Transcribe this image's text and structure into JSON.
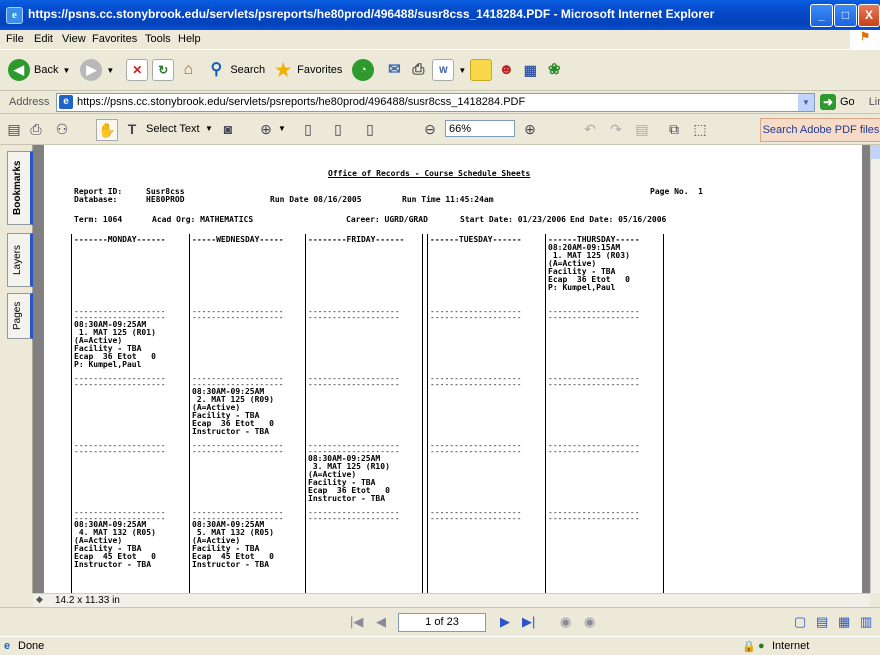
{
  "window": {
    "title": "https://psns.cc.stonybrook.edu/servlets/psreports/he80prod/496488/susr8css_1418284.PDF - Microsoft Internet Explorer",
    "app_icon": "ie-icon",
    "minimize": "_",
    "maximize": "□",
    "close": "X"
  },
  "menu": [
    "File",
    "Edit",
    "View",
    "Favorites",
    "Tools",
    "Help"
  ],
  "toolbar": {
    "back_label": "Back",
    "search_label": "Search",
    "favorites_label": "Favorites"
  },
  "address": {
    "label": "Address",
    "url": "https://psns.cc.stonybrook.edu/servlets/psreports/he80prod/496488/susr8css_1418284.PDF",
    "go_label": "Go",
    "links_label": "Links"
  },
  "pdf_toolbar": {
    "select_text": "Select Text",
    "zoom": "66%",
    "search_pdf": "Search Adobe PDF files"
  },
  "side_tabs": [
    "Bookmarks",
    "Layers",
    "Pages"
  ],
  "report": {
    "title": "Office of Records - Course Schedule Sheets",
    "report_id_label": "Report ID:",
    "report_id": "Susr8css",
    "database_label": "Database:",
    "database": "HE80PROD",
    "run_date": "Run Date 08/16/2005",
    "run_time": "Run Time 11:45:24am",
    "page_no": "Page No.  1",
    "term": "Term: 1064",
    "acad_org": "Acad Org: MATHEMATICS",
    "career": "Career: UGRD/GRAD",
    "start_date": "Start Date: 01/23/2006",
    "end_date": "End Date: 05/16/2006",
    "day_headers": [
      "-------MONDAY------",
      "-----WEDNESDAY-----",
      "--------FRIDAY------",
      "------TUESDAY------",
      "------THURSDAY-----"
    ],
    "entries": [
      {
        "day": "thursday",
        "lines": [
          "08:20AM-09:15AM",
          " 1. MAT 125 (R03)",
          "(A=Active)",
          "Facility - TBA",
          "Ecap  36 Etot   0",
          "P: Kumpel,Paul"
        ]
      },
      {
        "day": "monday",
        "lines": [
          "08:30AM-09:25AM",
          " 1. MAT 125 (R01)",
          "(A=Active)",
          "Facility - TBA",
          "Ecap  36 Etot   0",
          "P: Kumpel,Paul"
        ]
      },
      {
        "day": "wednesday",
        "lines": [
          "08:30AM-09:25AM",
          " 2. MAT 125 (R09)",
          "(A=Active)",
          "Facility - TBA",
          "Ecap  36 Etot   0",
          "Instructor - TBA"
        ]
      },
      {
        "day": "friday",
        "lines": [
          "08:30AM-09:25AM",
          " 3. MAT 125 (R10)",
          "(A=Active)",
          "Facility - TBA",
          "Ecap  36 Etot   0",
          "Instructor - TBA"
        ]
      },
      {
        "day": "monday",
        "lines": [
          "08:30AM-09:25AM",
          " 4. MAT 132 (R05)",
          "(A=Active)",
          "Facility - TBA",
          "Ecap  45 Etot   0",
          "Instructor - TBA"
        ]
      },
      {
        "day": "wednesday",
        "lines": [
          "08:30AM-09:25AM",
          " 5. MAT 132 (R05)",
          "(A=Active)",
          "Facility - TBA",
          "Ecap  45 Etot   0",
          "Instructor - TBA"
        ]
      }
    ],
    "row_separator": "-------------------"
  },
  "page_size": "14.2 x 11.33 in",
  "navigation": {
    "page_indicator": "1 of 23"
  },
  "status": {
    "text": "Done",
    "zone": "Internet"
  },
  "colors": {
    "titlebar": "#0548c8",
    "chrome": "#ece9d8",
    "doc_background": "#808080"
  }
}
